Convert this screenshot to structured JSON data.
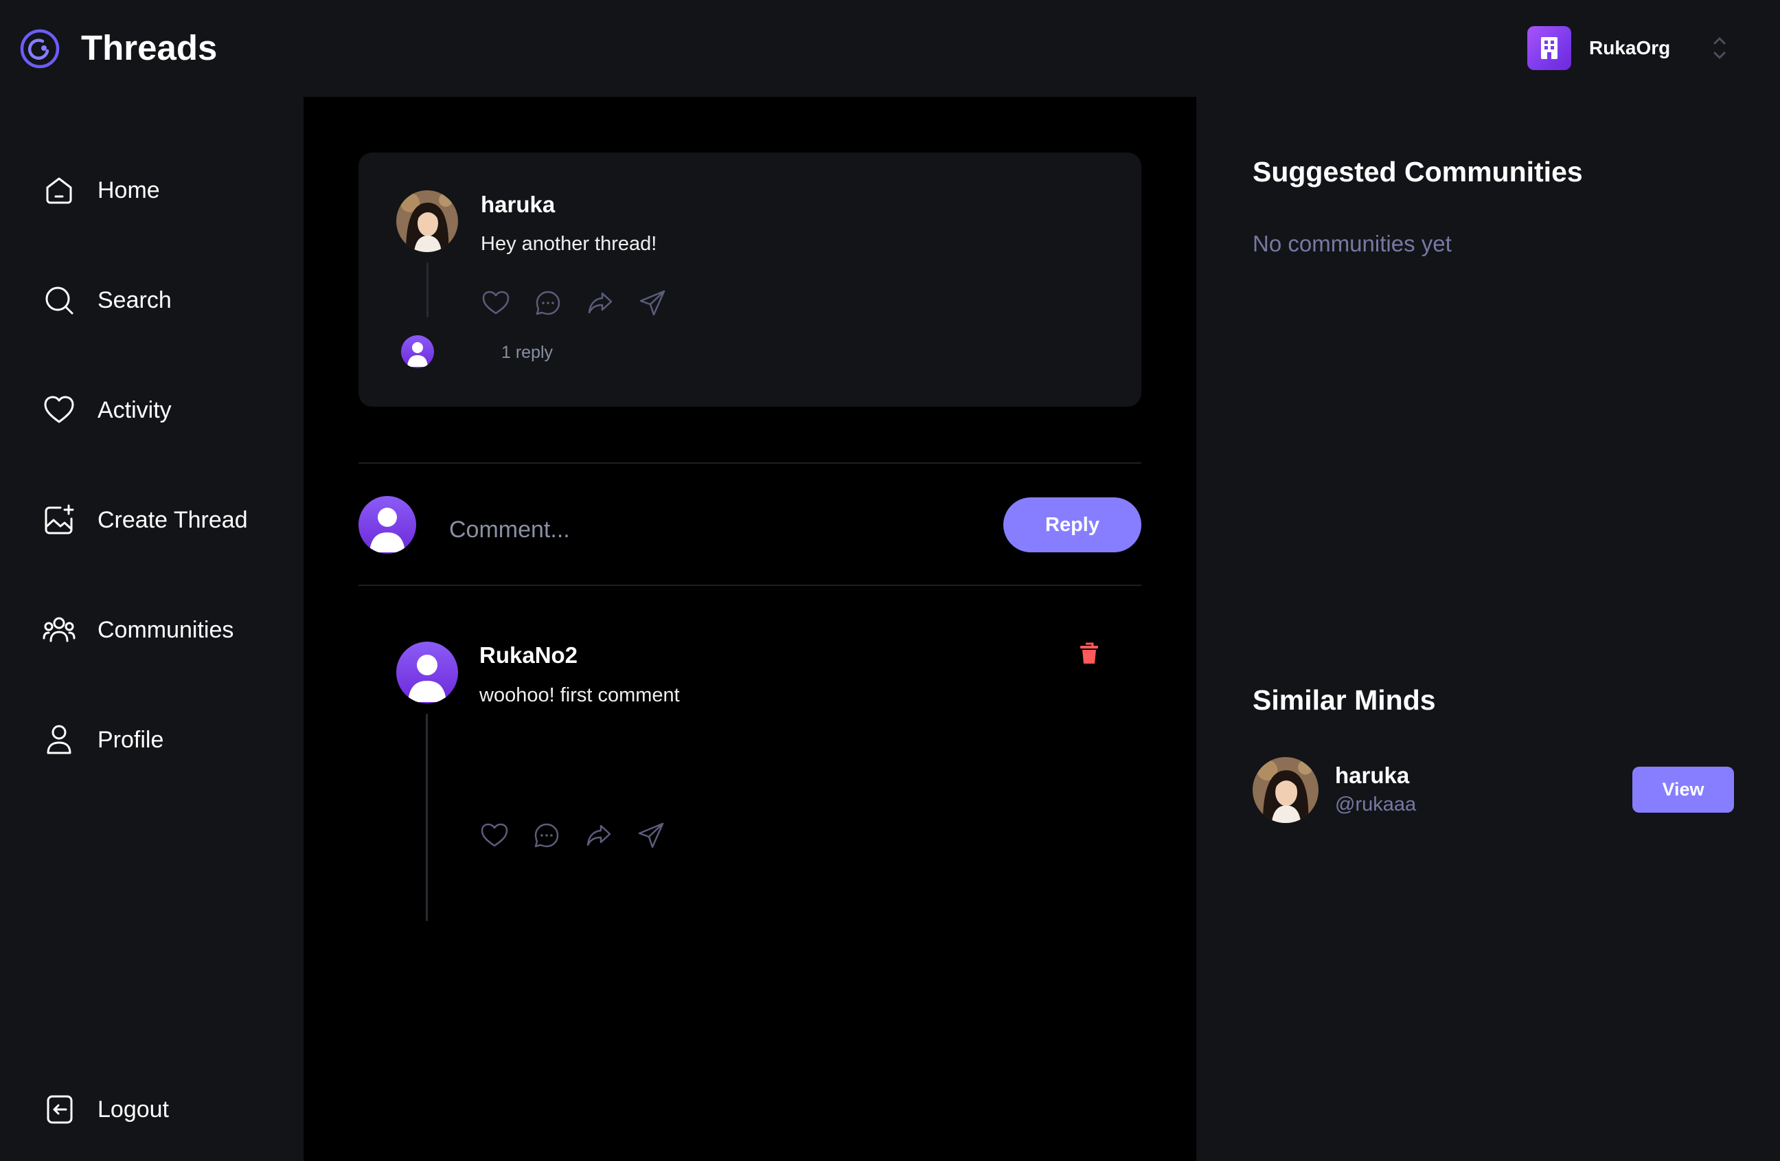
{
  "app": {
    "title": "Threads",
    "brand_color": "#877EFF"
  },
  "org_switcher": {
    "name": "RukaOrg",
    "icon": "building-icon"
  },
  "sidebar": {
    "items": [
      {
        "label": "Home",
        "icon": "home-icon"
      },
      {
        "label": "Search",
        "icon": "search-icon"
      },
      {
        "label": "Activity",
        "icon": "heart-icon"
      },
      {
        "label": "Create Thread",
        "icon": "image-plus-icon"
      },
      {
        "label": "Communities",
        "icon": "users-icon"
      },
      {
        "label": "Profile",
        "icon": "user-icon"
      }
    ],
    "logout": {
      "label": "Logout",
      "icon": "logout-icon"
    }
  },
  "thread": {
    "author": "haruka",
    "text": "Hey another thread!",
    "actions": [
      "heart-icon",
      "reply-icon",
      "repost-icon",
      "share-icon"
    ],
    "reply_count": "1 reply"
  },
  "comment_form": {
    "placeholder": "Comment...",
    "submit_label": "Reply"
  },
  "comments": [
    {
      "author": "RukaNo2",
      "text": "woohoo! first comment",
      "actions": [
        "heart-icon",
        "reply-icon",
        "repost-icon",
        "share-icon"
      ],
      "delete_icon": "delete-icon",
      "delete_color": "#FF5A5A"
    }
  ],
  "right_sidebar": {
    "suggested_communities": {
      "title": "Suggested Communities",
      "empty_text": "No communities yet"
    },
    "similar_minds": {
      "title": "Similar Minds",
      "users": [
        {
          "name": "haruka",
          "username": "@rukaaa",
          "action_label": "View"
        }
      ]
    }
  }
}
